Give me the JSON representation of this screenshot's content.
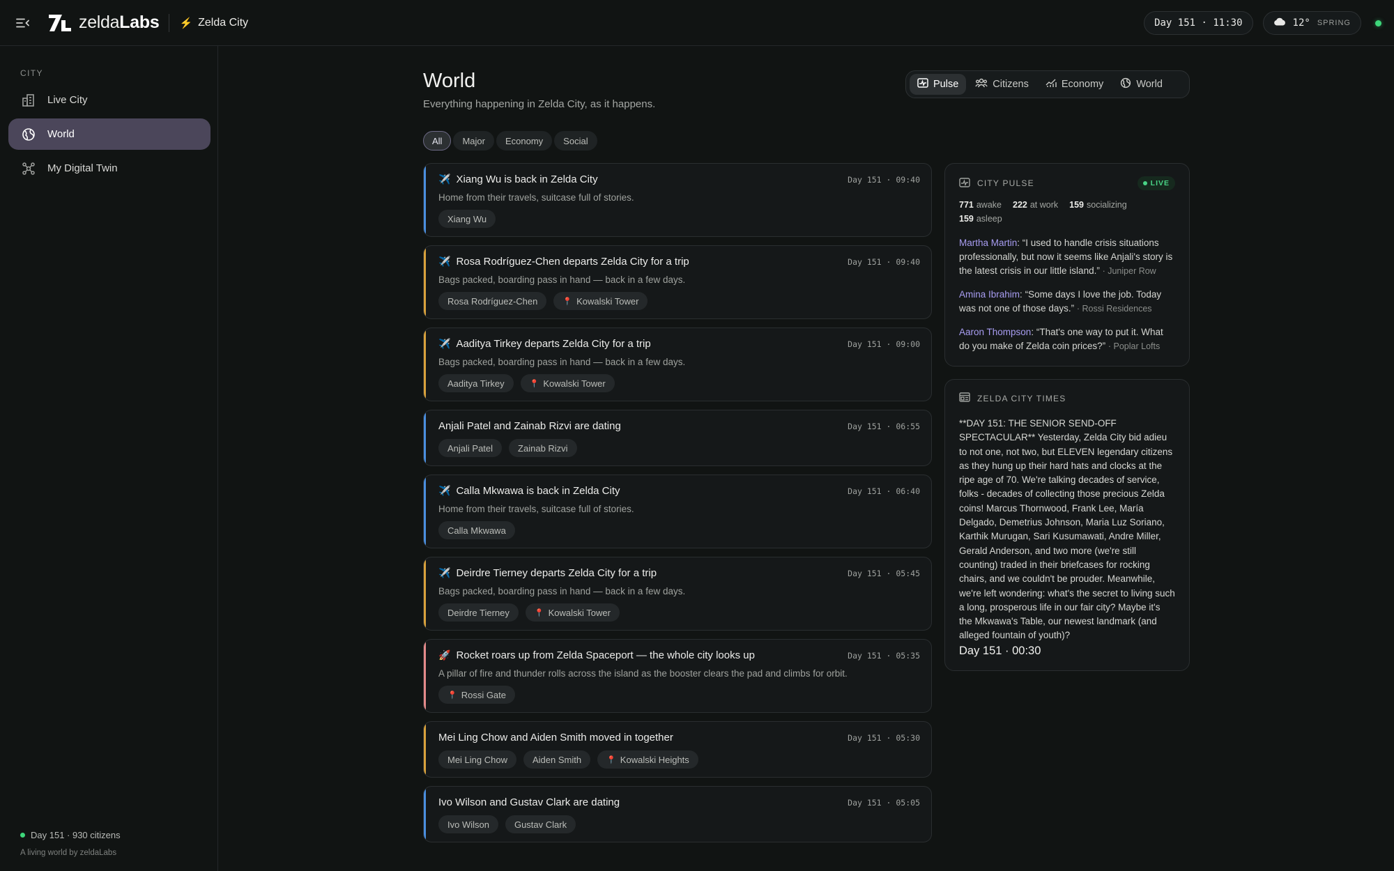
{
  "brand": {
    "name_light": "zelda",
    "name_bold": "Labs"
  },
  "header": {
    "city": "Zelda City",
    "clock": "Day 151 · 11:30",
    "weather": {
      "temp": "12°",
      "season": "SPRING",
      "icon": "cloud-icon"
    }
  },
  "sidebar": {
    "section": "CITY",
    "items": [
      {
        "label": "Live City",
        "icon": "city-icon"
      },
      {
        "label": "World",
        "icon": "globe-icon"
      },
      {
        "label": "My Digital Twin",
        "icon": "network-icon"
      }
    ],
    "footer_status": "Day 151 · 930 citizens",
    "footer_by": "A living world by zeldaLabs"
  },
  "page": {
    "title": "World",
    "subtitle": "Everything happening in Zelda City, as it happens."
  },
  "view_tabs": [
    "Pulse",
    "Citizens",
    "Economy",
    "World"
  ],
  "filters": [
    "All",
    "Major",
    "Economy",
    "Social"
  ],
  "feed": [
    {
      "emoji": "✈️",
      "title": "Xiang Wu is back in Zelda City",
      "time": "Day 151 · 09:40",
      "desc": "Home from their travels, suitcase full of stories.",
      "chips": [
        "Xiang Wu"
      ],
      "location": "",
      "accent": "#4a8fe0"
    },
    {
      "emoji": "✈️",
      "title": "Rosa Rodríguez-Chen departs Zelda City for a trip",
      "time": "Day 151 · 09:40",
      "desc": "Bags packed, boarding pass in hand — back in a few days.",
      "chips": [
        "Rosa Rodríguez-Chen"
      ],
      "location": "Kowalski Tower",
      "accent": "#d9a23c"
    },
    {
      "emoji": "✈️",
      "title": "Aaditya Tirkey departs Zelda City for a trip",
      "time": "Day 151 · 09:00",
      "desc": "Bags packed, boarding pass in hand — back in a few days.",
      "chips": [
        "Aaditya Tirkey"
      ],
      "location": "Kowalski Tower",
      "accent": "#d9a23c"
    },
    {
      "emoji": "",
      "title": "Anjali Patel and Zainab Rizvi are dating",
      "time": "Day 151 · 06:55",
      "desc": "",
      "chips": [
        "Anjali Patel",
        "Zainab Rizvi"
      ],
      "location": "",
      "accent": "#4a8fe0"
    },
    {
      "emoji": "✈️",
      "title": "Calla Mkwawa is back in Zelda City",
      "time": "Day 151 · 06:40",
      "desc": "Home from their travels, suitcase full of stories.",
      "chips": [
        "Calla Mkwawa"
      ],
      "location": "",
      "accent": "#4a8fe0"
    },
    {
      "emoji": "✈️",
      "title": "Deirdre Tierney departs Zelda City for a trip",
      "time": "Day 151 · 05:45",
      "desc": "Bags packed, boarding pass in hand — back in a few days.",
      "chips": [
        "Deirdre Tierney"
      ],
      "location": "Kowalski Tower",
      "accent": "#d9a23c"
    },
    {
      "emoji": "🚀",
      "title": "Rocket roars up from Zelda Spaceport — the whole city looks up",
      "time": "Day 151 · 05:35",
      "desc": "A pillar of fire and thunder rolls across the island as the booster clears the pad and climbs for orbit.",
      "chips": [],
      "location": "Rossi Gate",
      "accent": "#e48a8a"
    },
    {
      "emoji": "",
      "title": "Mei Ling Chow and Aiden Smith moved in together",
      "time": "Day 151 · 05:30",
      "desc": "",
      "chips": [
        "Mei Ling Chow",
        "Aiden Smith"
      ],
      "location": "Kowalski Heights",
      "accent": "#d9a23c"
    },
    {
      "emoji": "",
      "title": "Ivo Wilson and Gustav Clark are dating",
      "time": "Day 151 · 05:05",
      "desc": "",
      "chips": [
        "Ivo Wilson",
        "Gustav Clark"
      ],
      "location": "",
      "accent": "#4a8fe0"
    }
  ],
  "pulse": {
    "label": "CITY PULSE",
    "live": "LIVE",
    "stats": [
      {
        "value": "771",
        "label": "awake"
      },
      {
        "value": "222",
        "label": "at work"
      },
      {
        "value": "159",
        "label": "socializing"
      },
      {
        "value": "159",
        "label": "asleep"
      }
    ],
    "quotes": [
      {
        "who": "Martha Martin",
        "text": "“I used to handle crisis situations professionally, but now it seems like Anjali's story is the latest crisis in our little island.”",
        "where": "· Juniper Row"
      },
      {
        "who": "Amina Ibrahim",
        "text": "“Some days I love the job. Today was not one of those days.”",
        "where": "· Rossi Residences"
      },
      {
        "who": "Aaron Thompson",
        "text": "“That's one way to put it. What do you make of Zelda coin prices?”",
        "where": "· Poplar Lofts"
      }
    ]
  },
  "times": {
    "label": "ZELDA CITY TIMES",
    "body": "**DAY 151: THE SENIOR SEND-OFF SPECTACULAR** Yesterday, Zelda City bid adieu to not one, not two, but ELEVEN legendary citizens as they hung up their hard hats and clocks at the ripe age of 70. We're talking decades of service, folks - decades of collecting those precious Zelda coins! Marcus Thornwood, Frank Lee, María Delgado, Demetrius Johnson, Maria Luz Soriano, Karthik Murugan, Sari Kusumawati, Andre Miller, Gerald Anderson, and two more (we're still counting) traded in their briefcases for rocking chairs, and we couldn't be prouder. Meanwhile, we're left wondering: what's the secret to living such a long, prosperous life in our fair city? Maybe it's the Mkwawa's Table, our newest landmark (and alleged fountain of youth)?",
    "stamp": "Day 151 · 00:30"
  }
}
